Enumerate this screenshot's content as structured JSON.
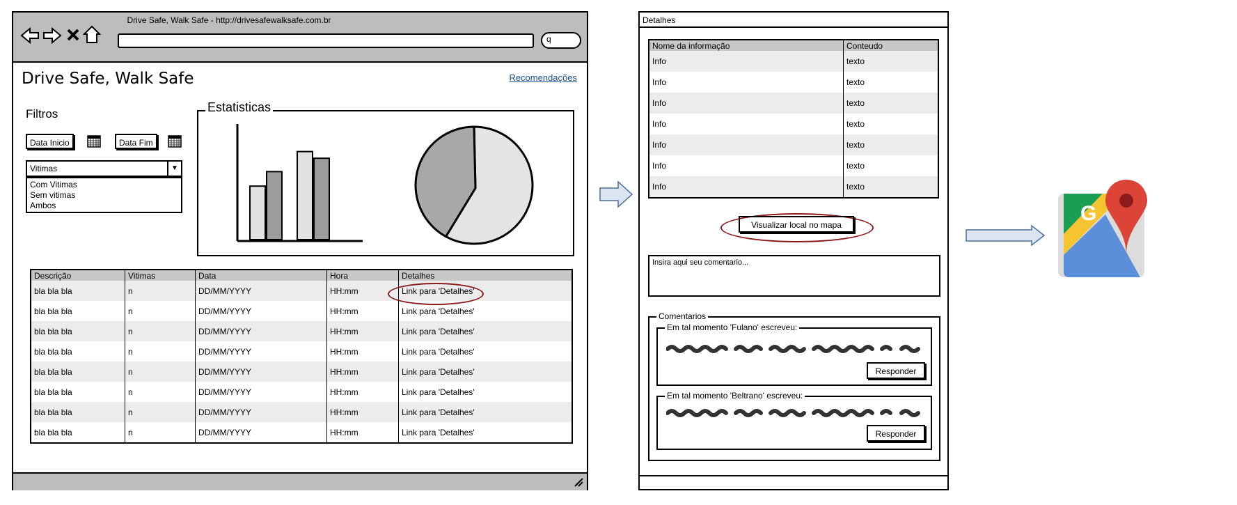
{
  "browser": {
    "title": "Drive Safe, Walk Safe - http://drivesafewalksafe.com.br",
    "nav_icons": [
      "back-arrow-icon",
      "forward-arrow-icon",
      "close-icon",
      "home-icon"
    ],
    "search_glyph": "q"
  },
  "app": {
    "title": "Drive Safe, Walk Safe",
    "recommendations_link": "Recomendações"
  },
  "filters": {
    "title": "Filtros",
    "date_start": "Data Inicio",
    "date_end": "Data Fim",
    "combo_selected": "Vitimas",
    "combo_options": [
      "Com Vitimas",
      "Sem vitimas",
      "Ambos"
    ]
  },
  "stats": {
    "title": "Estatisticas"
  },
  "chart_data": [
    {
      "type": "bar",
      "categories": [
        "",
        ""
      ],
      "series": [
        {
          "values": [
            48,
            79
          ]
        },
        {
          "values": [
            61,
            73
          ]
        }
      ],
      "ylim": [
        0,
        100
      ],
      "grid": false
    },
    {
      "type": "pie",
      "values": [
        58,
        42
      ],
      "colors": [
        "#e4e4e4",
        "#a8a8a8"
      ]
    }
  ],
  "main_table": {
    "headers": [
      "Descrição",
      "Vitimas",
      "Data",
      "Hora",
      "Detalhes"
    ],
    "rows": [
      [
        "bla bla bla",
        "n",
        "DD/MM/YYYY",
        "HH:mm",
        "Link para 'Detalhes'"
      ],
      [
        "bla bla bla",
        "n",
        "DD/MM/YYYY",
        "HH:mm",
        "Link para 'Detalhes'"
      ],
      [
        "bla bla bla",
        "n",
        "DD/MM/YYYY",
        "HH:mm",
        "Link para 'Detalhes'"
      ],
      [
        "bla bla bla",
        "n",
        "DD/MM/YYYY",
        "HH:mm",
        "Link para 'Detalhes'"
      ],
      [
        "bla bla bla",
        "n",
        "DD/MM/YYYY",
        "HH:mm",
        "Link para 'Detalhes'"
      ],
      [
        "bla bla bla",
        "n",
        "DD/MM/YYYY",
        "HH:mm",
        "Link para 'Detalhes'"
      ],
      [
        "bla bla bla",
        "n",
        "DD/MM/YYYY",
        "HH:mm",
        "Link para 'Detalhes'"
      ],
      [
        "bla bla bla",
        "n",
        "DD/MM/YYYY",
        "HH:mm",
        "Link para 'Detalhes'"
      ]
    ]
  },
  "details": {
    "header": "Detalhes",
    "table_headers": [
      "Nome da informação",
      "Conteudo"
    ],
    "rows": [
      [
        "Info",
        "texto"
      ],
      [
        "Info",
        "texto"
      ],
      [
        "Info",
        "texto"
      ],
      [
        "Info",
        "texto"
      ],
      [
        "Info",
        "texto"
      ],
      [
        "Info",
        "texto"
      ],
      [
        "Info",
        "texto"
      ]
    ],
    "map_button": "Visualizar local no mapa",
    "comment_placeholder": "Insira aqui seu comentario...",
    "comments_title": "Comentarios",
    "comments": [
      {
        "author_line": "Em tal momento 'Fulano' escreveu:",
        "reply": "Responder"
      },
      {
        "author_line": "Em tal momento 'Beltrano' escreveu:",
        "reply": "Responder"
      }
    ]
  },
  "colors": {
    "toolbar_gray": "#bdbdbd",
    "link_blue": "#1a4f96",
    "highlight_red": "#8b1a1a",
    "arrow_fill": "#dbe5f1",
    "arrow_stroke": "#4a6f9a"
  },
  "icons": {
    "calendar": "calendar-icon",
    "maps": "google-maps-icon",
    "arrow": "right-arrow-icon"
  }
}
